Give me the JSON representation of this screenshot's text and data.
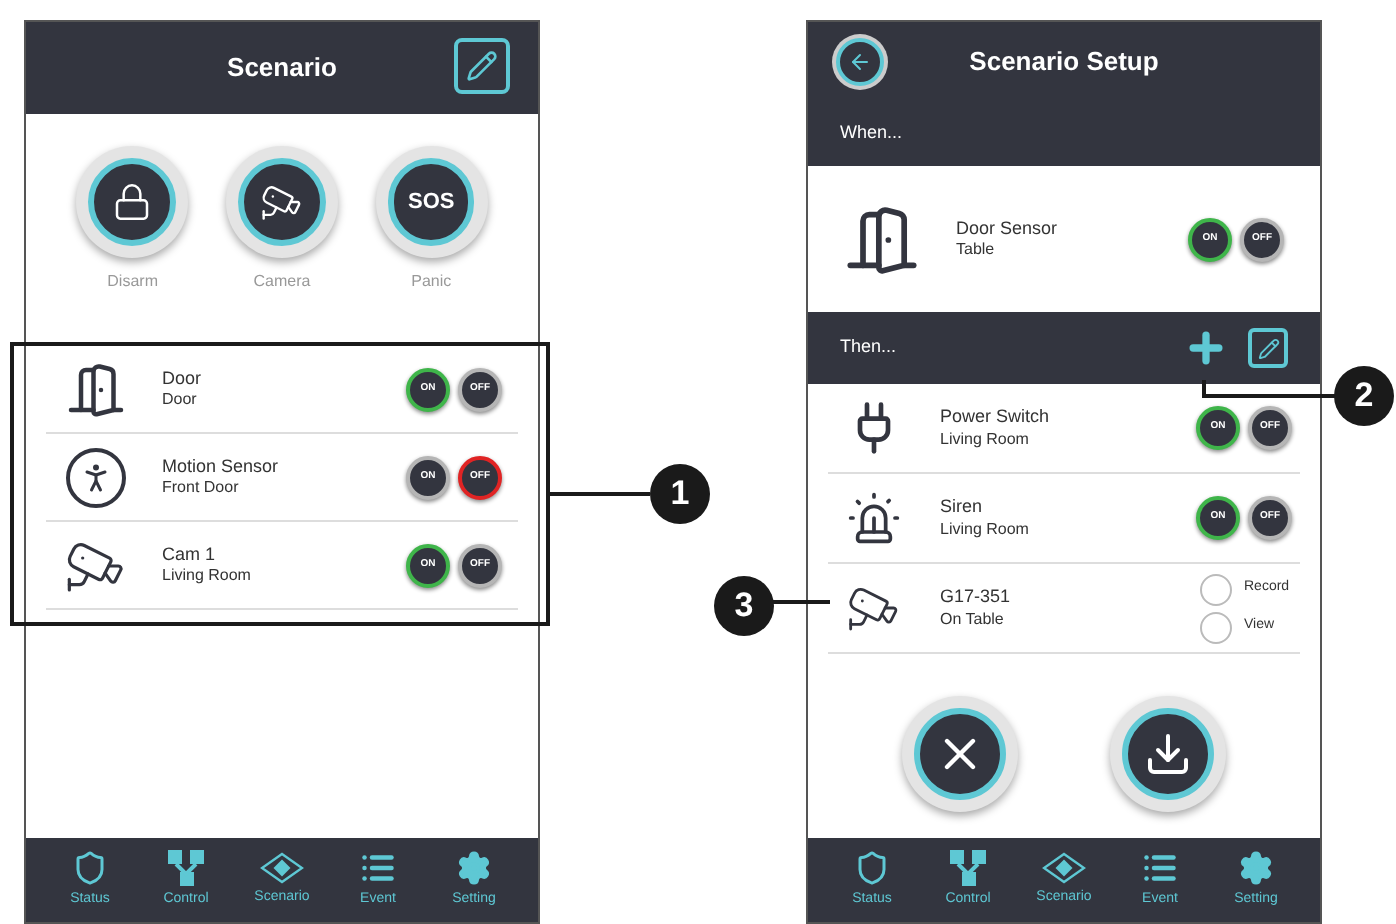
{
  "scenario_screen": {
    "title": "Scenario",
    "quick_actions": [
      {
        "kind": "icon",
        "label": "Disarm"
      },
      {
        "kind": "icon",
        "label": "Camera"
      },
      {
        "kind": "text",
        "glyph": "SOS",
        "label": "Panic"
      }
    ],
    "devices": [
      {
        "name": "Door",
        "location": "Door",
        "switches": [
          {
            "label": "ON",
            "kind": "on",
            "selected": true
          },
          {
            "label": "OFF",
            "kind": "off",
            "selected": false
          }
        ]
      },
      {
        "name": "Motion Sensor",
        "location": "Front Door",
        "switches": [
          {
            "label": "ON",
            "kind": "on",
            "selected": false
          },
          {
            "label": "OFF",
            "kind": "off",
            "selected": true
          }
        ]
      },
      {
        "name": "Cam 1",
        "location": "Living Room",
        "switches": [
          {
            "label": "ON",
            "kind": "on",
            "selected": true
          },
          {
            "label": "OFF",
            "kind": "off",
            "selected": false
          }
        ]
      }
    ],
    "tab_bar": [
      {
        "label": "Status"
      },
      {
        "label": "Control"
      },
      {
        "label": "Scenario"
      },
      {
        "label": "Event"
      },
      {
        "label": "Setting"
      }
    ]
  },
  "setup_screen": {
    "title": "Scenario Setup",
    "when_label": "When...",
    "when_device": {
      "name": "Door Sensor",
      "location": "Table",
      "switches": [
        {
          "label": "ON",
          "kind": "on",
          "selected": true
        },
        {
          "label": "OFF",
          "kind": "off",
          "selected": false
        }
      ]
    },
    "then_label": "Then...",
    "then_devices": [
      {
        "kind": "switch",
        "name": "Power Switch",
        "location": "Living Room",
        "switches": [
          {
            "label": "ON",
            "kind": "on",
            "selected": true
          },
          {
            "label": "OFF",
            "kind": "off",
            "selected": false
          }
        ]
      },
      {
        "kind": "switch",
        "name": "Siren",
        "location": "Living Room",
        "switches": [
          {
            "label": "ON",
            "kind": "on",
            "selected": true
          },
          {
            "label": "OFF",
            "kind": "off",
            "selected": false
          }
        ]
      },
      {
        "kind": "options",
        "name": "G17-351",
        "location": "On Table",
        "options": [
          {
            "label": "Record",
            "selected": false
          },
          {
            "label": "View",
            "selected": false
          }
        ]
      }
    ],
    "tab_bar": [
      {
        "label": "Status"
      },
      {
        "label": "Control"
      },
      {
        "label": "Scenario"
      },
      {
        "label": "Event"
      },
      {
        "label": "Setting"
      }
    ]
  },
  "callouts": [
    {
      "number": "1"
    },
    {
      "number": "2"
    },
    {
      "number": "3"
    }
  ]
}
